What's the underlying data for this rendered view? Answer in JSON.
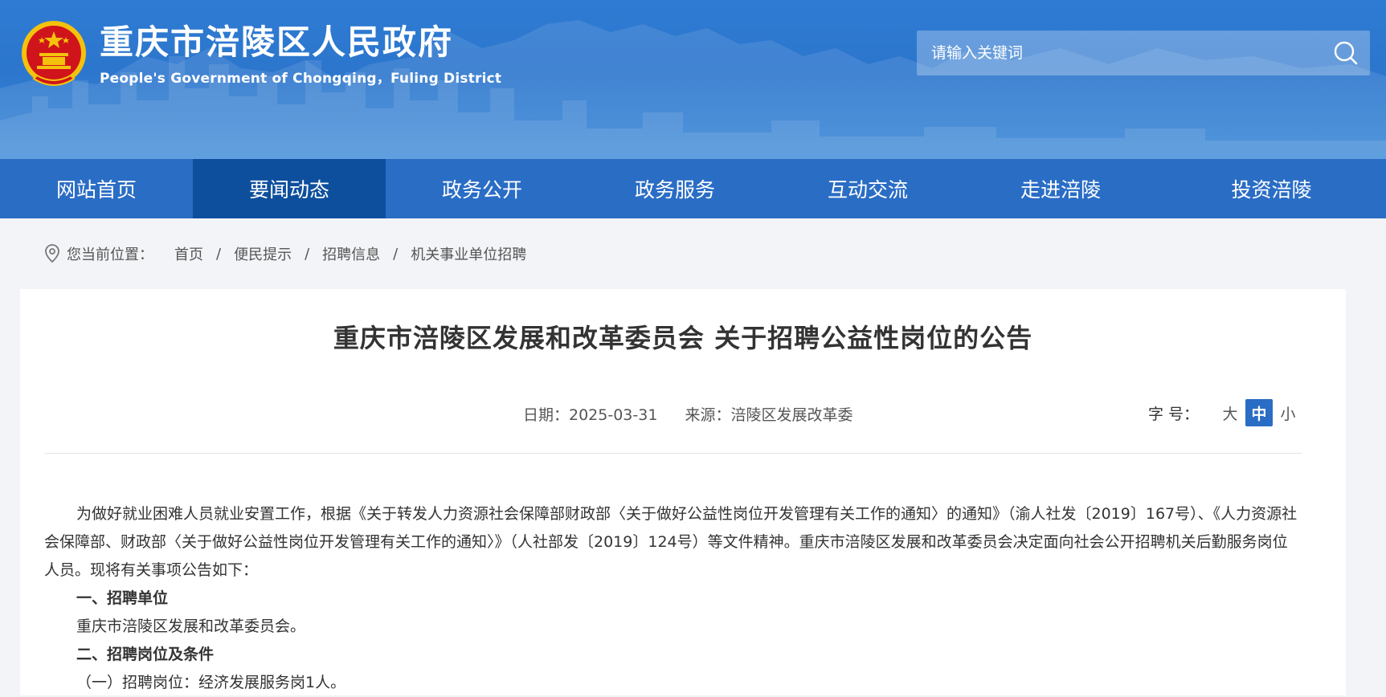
{
  "header": {
    "title_cn": "重庆市涪陵区人民政府",
    "title_en": "People's Government of Chongqing，Fuling District",
    "search_placeholder": "请输入关键词"
  },
  "icons": {
    "emblem": "national-emblem-icon",
    "search": "search-icon",
    "location": "location-pin-icon"
  },
  "nav": {
    "items": [
      {
        "label": "网站首页"
      },
      {
        "label": "要闻动态"
      },
      {
        "label": "政务公开"
      },
      {
        "label": "政务服务"
      },
      {
        "label": "互动交流"
      },
      {
        "label": "走进涪陵"
      },
      {
        "label": "投资涪陵"
      }
    ],
    "active_index": 1
  },
  "breadcrumb": {
    "prefix": "您当前位置：",
    "items": [
      "首页",
      "便民提示",
      "招聘信息",
      "机关事业单位招聘"
    ],
    "separator": "/"
  },
  "article": {
    "title": "重庆市涪陵区发展和改革委员会 关于招聘公益性岗位的公告",
    "date": "日期：2025-03-31",
    "source": "来源：涪陵区发展改革委",
    "font_size_label": "字 号：",
    "font_sizes": [
      "大",
      "中",
      "小"
    ],
    "font_size_active": "中",
    "paragraphs": {
      "intro": "为做好就业困难人员就业安置工作，根据《关于转发人力资源社会保障部财政部〈关于做好公益性岗位开发管理有关工作的通知〉的通知》（渝人社发〔2019〕167号）、《人力资源社会保障部、财政部〈关于做好公益性岗位开发管理有关工作的通知〉》（人社部发〔2019〕124号）等文件精神。重庆市涪陵区发展和改革委员会决定面向社会公开招聘机关后勤服务岗位人员。现将有关事项公告如下：",
      "h1": "一、招聘单位",
      "p1": "重庆市涪陵区发展和改革委员会。",
      "h2": "二、招聘岗位及条件",
      "p2": "（一）招聘岗位：经济发展服务岗1人。"
    }
  },
  "colors": {
    "header_blue": "#2f7bd3",
    "nav_blue": "#2a6dc5",
    "nav_active": "#0d4f9d",
    "emblem_red": "#d0141b",
    "emblem_gold": "#f4c20d"
  }
}
